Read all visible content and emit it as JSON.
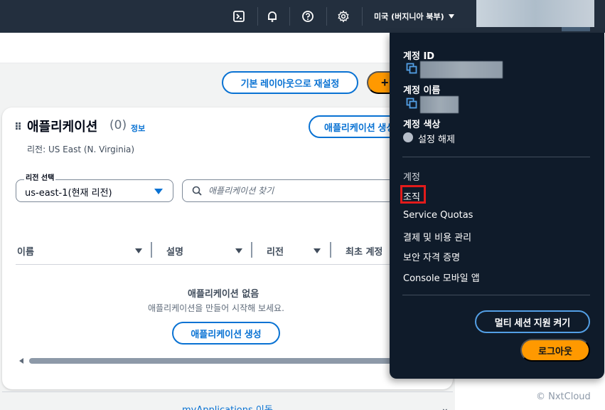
{
  "topnav": {
    "icons": [
      "cloudshell-icon",
      "bell-icon",
      "help-icon",
      "gear-icon"
    ],
    "region_label": "미국 (버지니아 북부)"
  },
  "toolbar": {
    "reset_layout_label": "기본 레이아웃으로 재설정",
    "add_label": "+"
  },
  "card": {
    "title": "애플리케이션",
    "count": "(0)",
    "info_link": "정보",
    "create_button_label": "애플리케이션 생성",
    "region_text": "리전: US East (N. Virginia)",
    "region_select": {
      "label": "리전 선택",
      "value": "us-east-1(현재 리전)"
    },
    "search": {
      "placeholder": "애플리케이션 찾기"
    },
    "columns": [
      "이름",
      "설명",
      "리전",
      "최초 계정"
    ],
    "empty": {
      "title": "애플리케이션 없음",
      "subtitle": "애플리케이션을 만들어 시작해 보세요.",
      "button_label": "애플리케이션 생성"
    },
    "footer_link": "myApplications 이동"
  },
  "account_menu": {
    "account_id_label": "계정 ID",
    "account_name_label": "계정 이름",
    "account_color_label": "계정 색상",
    "account_color_value": "설정 해제",
    "items": [
      "계정",
      "조직",
      "Service Quotas",
      "결제 및 비용 관리",
      "보안 자격 증명",
      "Console 모바일 앱"
    ],
    "highlighted_item": "조직",
    "multi_session_label": "멀티 세션 지원 켜기",
    "logout_label": "로그아웃"
  },
  "watermark": "© NxtCloud",
  "colors": {
    "nav_bg": "#232f3e",
    "menu_bg": "#0f1b2a",
    "link_blue": "#0972d3",
    "primary_orange": "#ff9900",
    "highlight_red": "#e21b1b"
  }
}
